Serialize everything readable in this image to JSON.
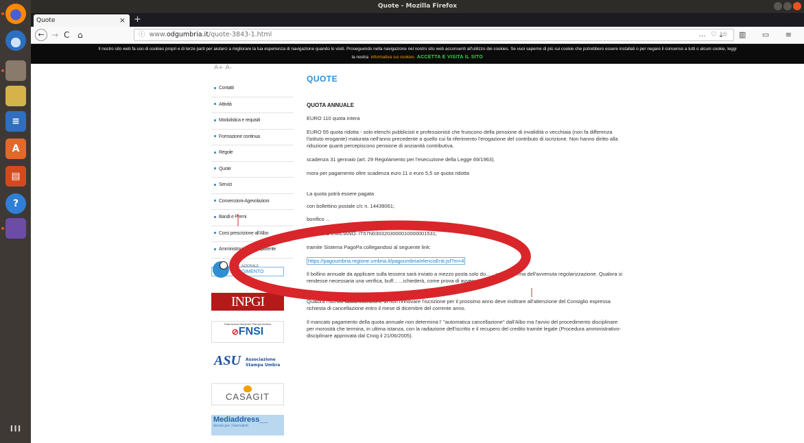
{
  "window": {
    "title": "Quote - Mozilla Firefox"
  },
  "tab": {
    "label": "Quote",
    "close": "×",
    "new_tab": "+"
  },
  "nav": {
    "back": "←",
    "forward": "→",
    "reload": "C",
    "home": "⌂",
    "info_icon": "ⓘ",
    "url_prefix": "www.",
    "url_host": "odgumbria.it",
    "url_path": "/quote-3843-1.html",
    "url_actions": "… ♡ ☆",
    "toolbar_icons": "⤓ ▥ ▭ ≡"
  },
  "cookie_banner": {
    "text": "Il nostro sito web fa uso di cookies propri e di terze parti per aiutarci a migliorare la tua esperienza di navigazione quando lo visiti. Proseguendo nella navigazione nel nostro sito web acconsenti all'utilizzo dei cookies. Se vuoi saperne di più sui cookie che potrebbero essere installati o per negare il consenso a tutti o alcuni cookie, leggi",
    "text2": "la nostra",
    "link": "informativa sui cookies",
    "accept": "ACCETTA E VISITA IL SITO"
  },
  "sidebar": {
    "partial_top": "A+        A-",
    "items": [
      {
        "label": "Contatti"
      },
      {
        "label": "Attività"
      },
      {
        "label": "Modulistica e requisiti"
      },
      {
        "label": "Formazione continua"
      },
      {
        "label": "Regole"
      },
      {
        "label": "Quote"
      },
      {
        "label": "Servizi"
      },
      {
        "label": "Convenzioni-Agevolazioni"
      },
      {
        "label": "Bandi e Premi"
      },
      {
        "label": "Corsi prescrizione all'Albo"
      },
      {
        "label": "Amministrazione Trasparente"
      }
    ],
    "button_partial": "RI          GGIMENTO",
    "logos": {
      "inpgi": "INPGI",
      "fnsi_top": "Federazione Nazionale Stampa Italiana",
      "fnsi": "FNSI",
      "asu_line1": "Associazione",
      "asu_line2": "Stampa Umbra",
      "casagit": "CASAGIT",
      "mediaddress": "Mediaddress__",
      "mediaddress_sub": "Servizi per i Giornalisti",
      "cnog_partial": "...AZIONALE"
    }
  },
  "content": {
    "title": "QUOTE",
    "subtitle": "QUOTA ANNUALE",
    "p1": "EURO 110 quota  intera",
    "p2": "EURO 55 quota ridotta - solo elenchi pubblicisti e professionisti che fruiscono della pensione di invalidità o vecchiaia  (non fa differenza l'istituto erogante)  maturata nell'anno precedente a quello cui fa riferimento l'erogazione del contributo di iscrizione. Non hanno diritto alla riduzione quanti percepiscono pensione di anzianità contributiva.",
    "p3": "scadenza 31 gennaio  (art. 29 Regolamento per l'esecuzione della Legge 69/1963).",
    "p4": "mora per pagamento oltre scadenza euro 11 o euro 5,5 se quota ridotta",
    "p5": "La quota potrà essere pagata",
    "p6": "con bollettino postale c/c n. 14439061;",
    "p7_partial": "bonifico ...",
    "p8": "CREDITO EMILIANO: IT57N0303203000010000001531;",
    "p9": "tramite Sistema PagoPa collegandosi al seguente link:",
    "link": "https://pagoumbria.regione.umbria.it/pagoumbria/elencoEnti.jsf?m=4",
    "p10": "Il bollino annuale da applicare sulla tessera sarà inviato a mezzo posta solo do...     ...vrà conferma dell'avvenuta regolarizzazione. Qualora si rendesse necessaria una verifica, buff...          ...ichiederà, come prova di avvenuto",
    "p11": "Qualora l'iscritto abbia intenzione di non rinnovare l'iscrizione per il prossimo anno deve inoltrare all'attenzione del Consiglio espressa richiesta di cancellazione entro il mese di dicembre del corrente anno.",
    "p12": "Il mancato pagamento della quota annuale non determina l' \"automatica cancellazione\" dall'Albo ma l'avvio del procedimento disciplinare per morosità che termina, in ultima istanza, con la radiazione dell'iscritto e il recupero del credito tramite legale (Procedura amministrativo-disciplinare approvata dal Cnog il 21/06/2005)."
  },
  "colors": {
    "accent": "#2e8fd1",
    "annotation": "#d9262b",
    "cookie_link": "#f2a100",
    "cookie_accept": "#3fd24a",
    "launcher": "#3e3935"
  }
}
